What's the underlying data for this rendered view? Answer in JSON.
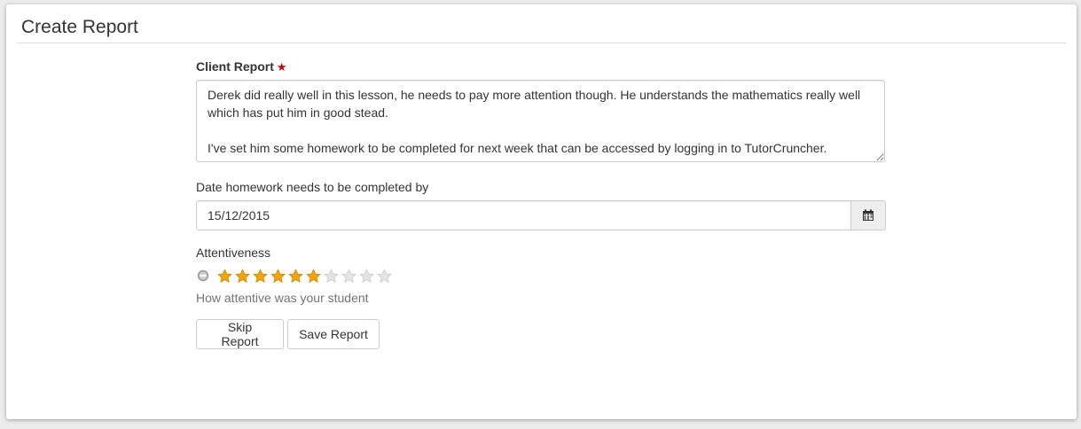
{
  "panel": {
    "title": "Create Report"
  },
  "client_report": {
    "label": "Client Report",
    "required_marker": "★",
    "value": "Derek did really well in this lesson, he needs to pay more attention though. He understands the mathematics really well which has put him in good stead.\n\nI've set him some homework to be completed for next week that can be accessed by logging in to TutorCruncher."
  },
  "homework_date": {
    "label": "Date homework needs to be completed by",
    "value": "15/12/2015",
    "addon_icon": "calendar-icon"
  },
  "attentiveness": {
    "label": "Attentiveness",
    "rating": 6,
    "max_rating": 10,
    "help_text": "How attentive was your student",
    "clear_icon": "minus-circle-icon",
    "star_icon": "star-icon",
    "colors": {
      "star_filled": "#f0a30a",
      "star_empty": "#e3e3e3",
      "clear_icon": "#9a9a9a"
    }
  },
  "buttons": {
    "skip_label": "Skip Report",
    "save_label": "Save Report"
  },
  "colors": {
    "required_star": "#cc0000",
    "panel_background": "#ffffff",
    "page_background": "#ececec",
    "help_text": "#737373"
  }
}
